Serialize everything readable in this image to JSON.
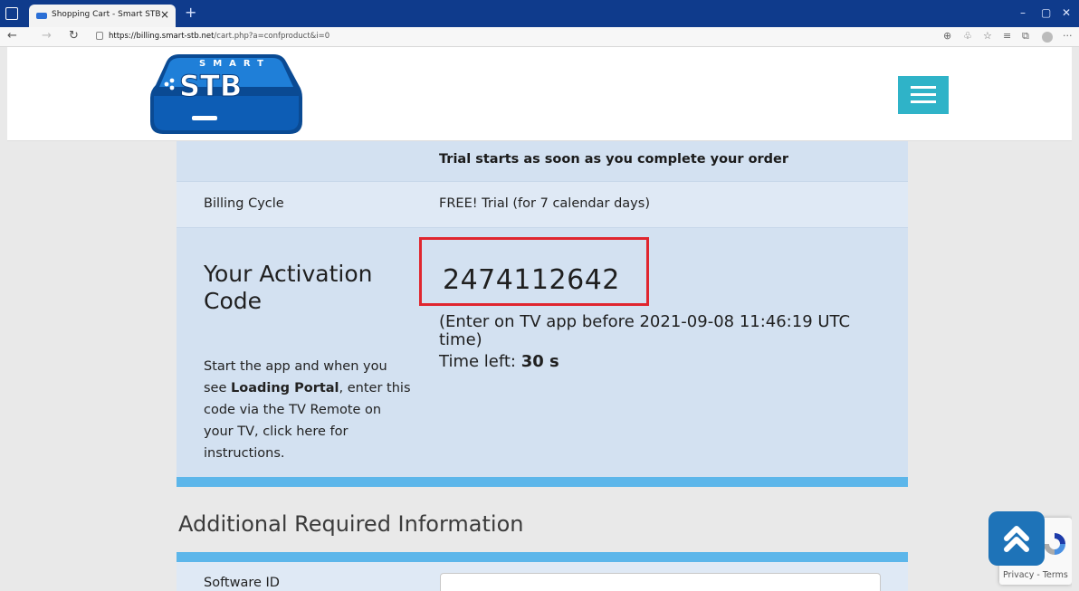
{
  "browser": {
    "tab_title": "Shopping Cart - Smart STB",
    "tab_close": "×",
    "new_tab": "+",
    "url_host": "https://billing.smart-stb.net",
    "url_path": "/cart.php?a=confproduct&i=0",
    "minimize": "–",
    "maximize": "▢",
    "close": "✕",
    "more": "···"
  },
  "header": {
    "logo_top": "SMART",
    "logo_main": "STB"
  },
  "card": {
    "trial_note": "Trial starts as soon as you complete your order",
    "billing_cycle_label": "Billing Cycle",
    "billing_cycle_value": "FREE! Trial (for 7 calendar days)",
    "activation_title": "Your Activation Code",
    "help_pre": "Start the app and when you see ",
    "help_bold": "Loading Portal",
    "help_post": ", enter this code via the TV Remote on your TV, click here for instructions.",
    "activation_code": "2474112642",
    "expire_text": "(Enter on TV app before 2021-09-08 11:46:19 UTC time)",
    "time_left_label": "Time left: ",
    "time_left_value": "30 s"
  },
  "additional": {
    "title": "Additional Required Information",
    "software_id_label": "Software ID",
    "software_id_value": ""
  },
  "recaptcha": {
    "links": "Privacy - Terms"
  },
  "colors": {
    "accent_teal": "#2fb3c8",
    "stripe_blue": "#5cb6ea",
    "highlight_red": "#e0262f",
    "scroll_btn": "#1e73b8"
  }
}
